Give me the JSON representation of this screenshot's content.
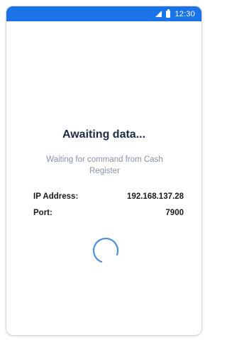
{
  "status_bar": {
    "time": "12:30",
    "icons": [
      "signal-icon",
      "battery-icon"
    ],
    "color": "#1a73e8"
  },
  "main": {
    "title": "Awaiting data...",
    "subtitle": "Waiting for command from Cash Register",
    "info": {
      "ip_label": "IP Address:",
      "ip_value": "192.168.137.28",
      "port_label": "Port:",
      "port_value": "7900"
    },
    "spinner": {
      "icon": "loading-spinner-icon",
      "color": "#4a90e2"
    }
  }
}
